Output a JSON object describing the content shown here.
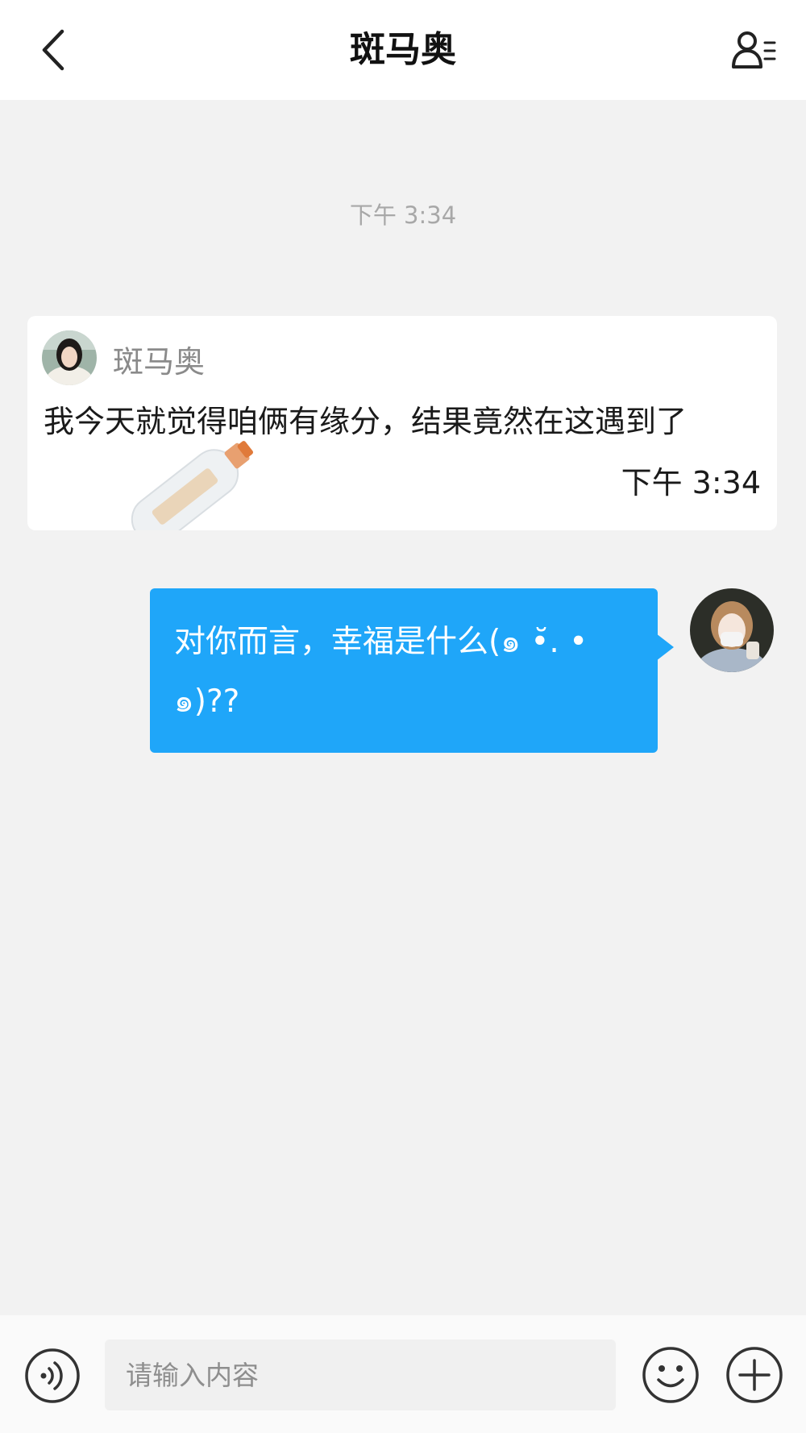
{
  "header": {
    "title": "斑马奥",
    "back_icon": "chevron-left-icon",
    "profile_icon": "user-list-icon"
  },
  "chat": {
    "timestamp": "下午 3:34",
    "card": {
      "sender_name": "斑马奥",
      "message": "我今天就觉得咱俩有缘分，结果竟然在这遇到了",
      "time": "下午 3:34",
      "decoration_icon": "message-bottle-icon"
    },
    "my_message": {
      "text": "对你而言，幸福是什么(๑ •̆. • ๑)??",
      "bubble_color": "#1fa6f9"
    }
  },
  "input_bar": {
    "placeholder": "请输入内容",
    "voice_icon": "voice-icon",
    "emoji_icon": "emoji-icon",
    "plus_icon": "plus-circle-icon"
  }
}
